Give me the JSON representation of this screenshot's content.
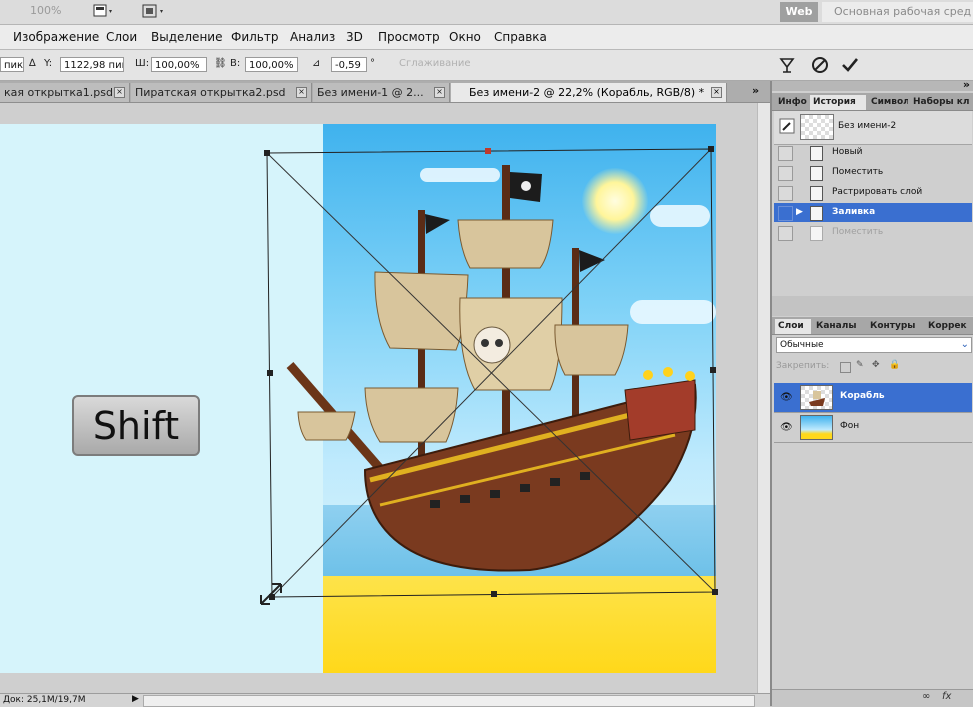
{
  "appbar": {
    "zoom": "100%",
    "workspace_button": "Web",
    "workspace_name": "Основная рабочая сред"
  },
  "menu": [
    "Изображение",
    "Слои",
    "Выделение",
    "Фильтр",
    "Анализ",
    "3D",
    "Просмотр",
    "Окно",
    "Справка"
  ],
  "options": {
    "x_value": "пик",
    "y_label": "Y:",
    "y_value": "1122,98 пик",
    "w_label": "Ш:",
    "w_value": "100,00%",
    "h_label": "В:",
    "h_value": "100,00%",
    "angle_value": "-0,59",
    "smoothing_label": "Сглаживание",
    "cancel_icon": "cancel-icon",
    "commit_icon": "check-icon"
  },
  "tabs": [
    {
      "label": "кая открытка1.psd"
    },
    {
      "label": "Пиратская открытка2.psd"
    },
    {
      "label": "Без имени-1 @ 2..."
    },
    {
      "label": "Без имени-2 @ 22,2% (Корабль, RGB/8) *"
    }
  ],
  "canvas": {
    "shift_key_label": "Shift"
  },
  "status": {
    "doc_info": "Док: 25,1M/19,7M"
  },
  "history_panel": {
    "tabs": [
      "Инфо",
      "История",
      "Символ",
      "Наборы кл"
    ],
    "snapshot_label": "Без имени-2",
    "items": [
      {
        "label": "Новый"
      },
      {
        "label": "Поместить"
      },
      {
        "label": "Растрировать слой"
      },
      {
        "label": "Заливка"
      },
      {
        "label": "Поместить"
      }
    ]
  },
  "layers_panel": {
    "tabs": [
      "Слои",
      "Каналы",
      "Контуры",
      "Коррек"
    ],
    "blend_mode": "Обычные",
    "lock_label": "Закрепить:",
    "layers": [
      {
        "name": "Корабль",
        "selected": true
      },
      {
        "name": "Фон",
        "selected": false
      }
    ]
  },
  "colors": {
    "selection_blue": "#3a6fd0",
    "panel_gray": "#cfcfcf"
  }
}
